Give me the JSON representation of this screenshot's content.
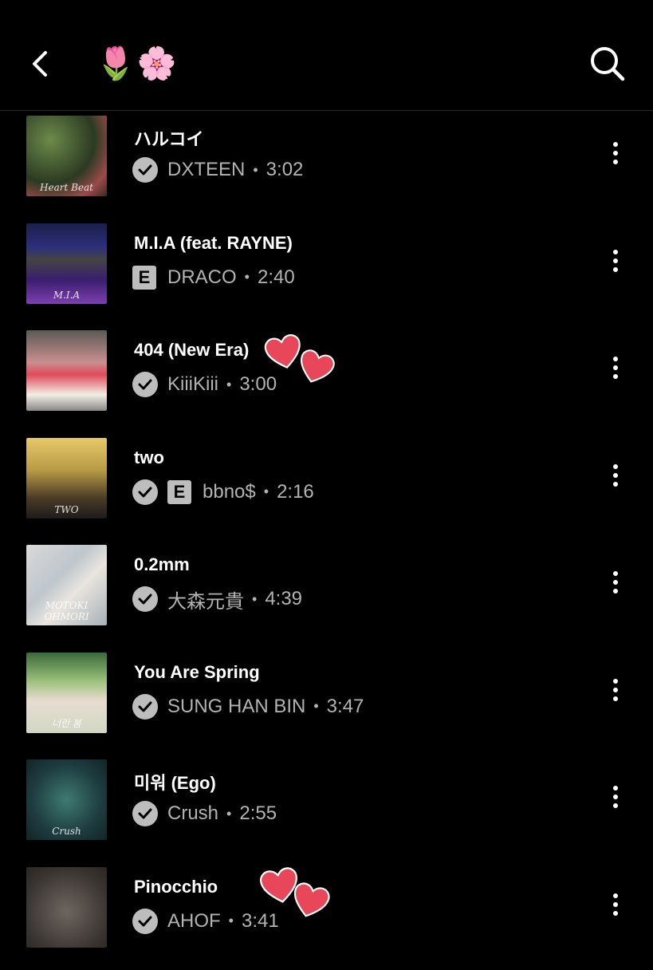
{
  "header": {
    "title": "🌷🌸",
    "back_icon": "chevron-left-icon",
    "search_icon": "search-icon"
  },
  "tracks": [
    {
      "title": "ハルコイ",
      "artist": "DXTEEN",
      "duration": "3:02",
      "verified": true,
      "explicit": false,
      "art_text": "Heart Beat"
    },
    {
      "title": "M.I.A (feat. RAYNE)",
      "artist": "DRACO",
      "duration": "2:40",
      "verified": false,
      "explicit": true,
      "art_text": "M.I.A"
    },
    {
      "title": "404 (New Era)",
      "artist": "KiiiKiii",
      "duration": "3:00",
      "verified": true,
      "explicit": false,
      "art_text": ""
    },
    {
      "title": "two",
      "artist": "bbno$",
      "duration": "2:16",
      "verified": true,
      "explicit": true,
      "art_text": "TWO"
    },
    {
      "title": "0.2mm",
      "artist": "大森元貴",
      "duration": "4:39",
      "verified": true,
      "explicit": false,
      "art_text": "MOTOKI OHMORI"
    },
    {
      "title": "You Are Spring",
      "artist": "SUNG HAN BIN",
      "duration": "3:47",
      "verified": true,
      "explicit": false,
      "art_text": "너란 봄"
    },
    {
      "title": "미워 (Ego)",
      "artist": "Crush",
      "duration": "2:55",
      "verified": true,
      "explicit": false,
      "art_text": "Crush"
    },
    {
      "title": "Pinocchio",
      "artist": "AHOF",
      "duration": "3:41",
      "verified": true,
      "explicit": false,
      "art_text": ""
    }
  ],
  "labels": {
    "separator": "•",
    "explicit_badge": "E"
  },
  "colors": {
    "background": "#000000",
    "heart": "#e8475a",
    "badge": "#bdbdbd",
    "meta_text": "#b3b3b3"
  }
}
